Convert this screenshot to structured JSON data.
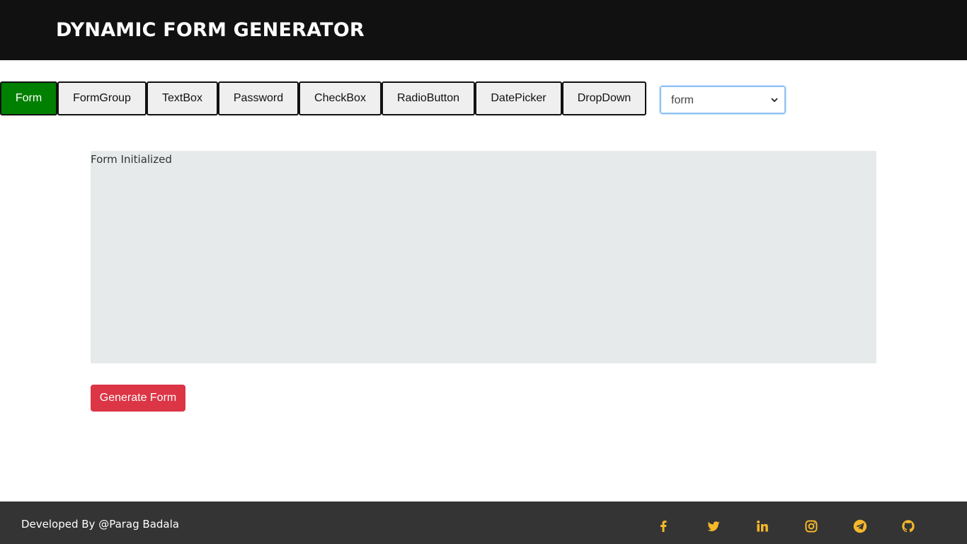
{
  "header": {
    "title": "DYNAMIC FORM GENERATOR"
  },
  "tabs": [
    {
      "label": "Form",
      "active": true
    },
    {
      "label": "FormGroup",
      "active": false
    },
    {
      "label": "TextBox",
      "active": false
    },
    {
      "label": "Password",
      "active": false
    },
    {
      "label": "CheckBox",
      "active": false
    },
    {
      "label": "RadioButton",
      "active": false
    },
    {
      "label": "DatePicker",
      "active": false
    },
    {
      "label": "DropDown",
      "active": false
    }
  ],
  "select": {
    "value": "form",
    "options": [
      "form"
    ]
  },
  "form_area": {
    "status": "Form Initialized"
  },
  "generate_button": {
    "label": "Generate Form"
  },
  "footer": {
    "credit": "Developed By @Parag Badala",
    "social_icons": [
      "facebook-icon",
      "twitter-icon",
      "linkedin-icon",
      "instagram-icon",
      "telegram-icon",
      "github-icon"
    ]
  },
  "colors": {
    "header_bg": "#111111",
    "active_tab": "#008000",
    "generate_button": "#dc3545",
    "form_area_bg": "#e7eaeb",
    "footer_bg": "#343434",
    "social_icon": "#f5b82a"
  }
}
